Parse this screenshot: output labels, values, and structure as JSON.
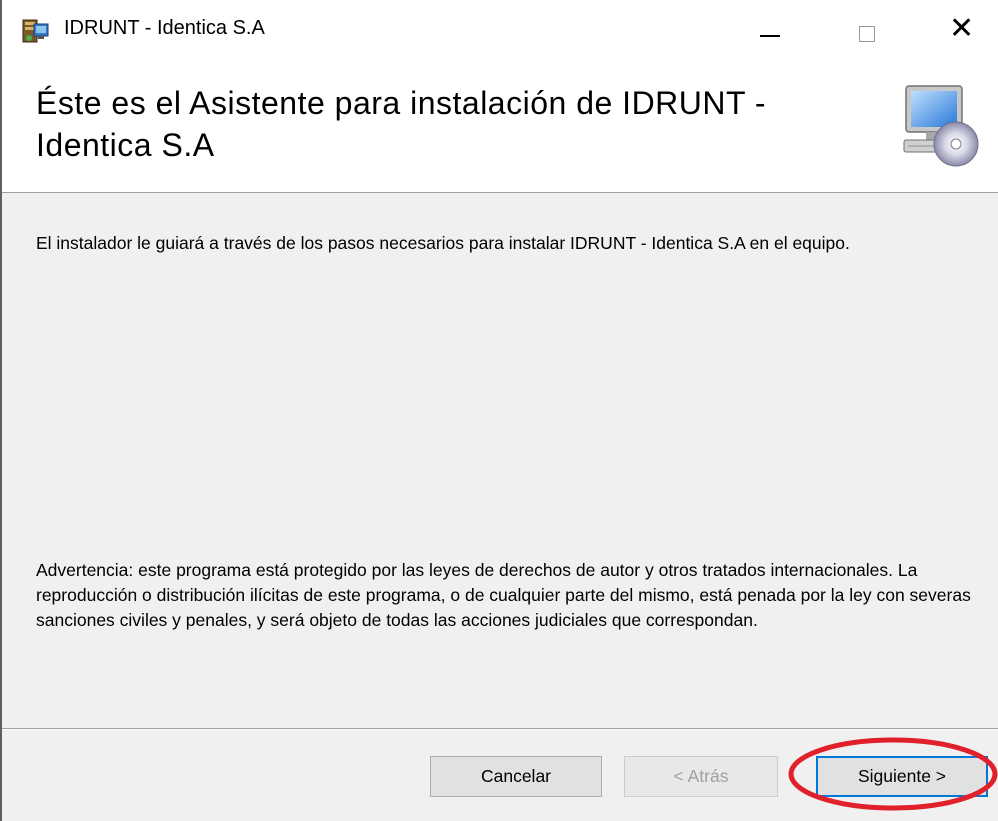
{
  "window": {
    "title": "IDRUNT - Identica S.A",
    "controls": [
      "minimize",
      "maximize",
      "close"
    ]
  },
  "banner": {
    "heading": "Éste es el Asistente para instalación de IDRUNT - Identica S.A",
    "icon": "computer-cd-icon"
  },
  "content": {
    "intro": "El instalador le guiará a través de los pasos necesarios para instalar IDRUNT - Identica S.A en el equipo.",
    "warning": "Advertencia: este programa está protegido por las leyes de derechos de autor y otros tratados internacionales. La reproducción o distribución ilícitas de este programa, o de cualquier parte del mismo, está penada por la ley con severas sanciones civiles y penales, y será objeto de todas las acciones judiciales que correspondan."
  },
  "footer": {
    "cancel_label": "Cancelar",
    "back_label": "< Atrás",
    "next_label": "Siguiente >"
  },
  "annotation": {
    "highlight_color": "#e0202a",
    "highlight_target": "next-button"
  }
}
